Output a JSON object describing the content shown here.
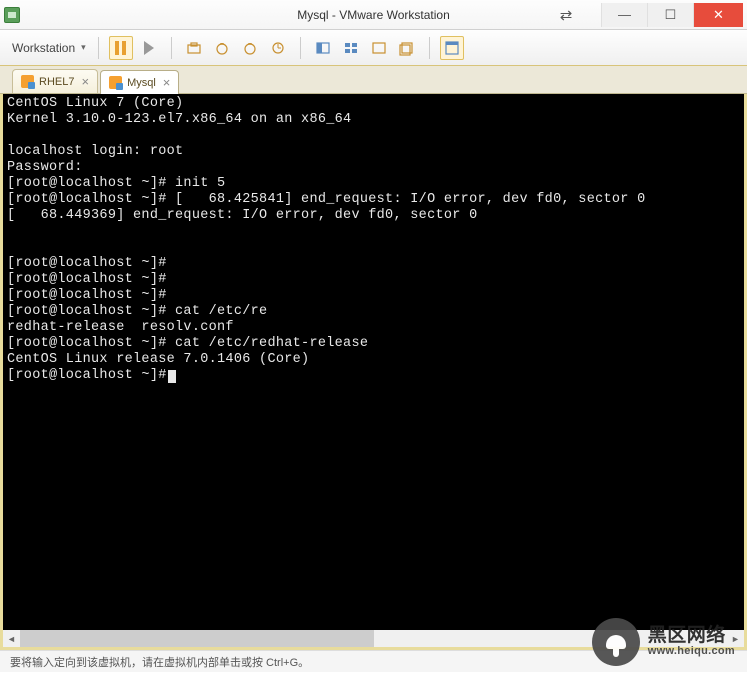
{
  "window": {
    "title": "Mysql - VMware Workstation"
  },
  "toolbar": {
    "menu_label": "Workstation"
  },
  "tabs": [
    {
      "label": "RHEL7",
      "active": false
    },
    {
      "label": "Mysql",
      "active": true
    }
  ],
  "terminal": {
    "lines": [
      "CentOS Linux 7 (Core)",
      "Kernel 3.10.0-123.el7.x86_64 on an x86_64",
      "",
      "localhost login: root",
      "Password:",
      "[root@localhost ~]# init 5",
      "[root@localhost ~]# [   68.425841] end_request: I/O error, dev fd0, sector 0",
      "[   68.449369] end_request: I/O error, dev fd0, sector 0",
      "",
      "",
      "[root@localhost ~]#",
      "[root@localhost ~]#",
      "[root@localhost ~]#",
      "[root@localhost ~]# cat /etc/re",
      "redhat-release  resolv.conf",
      "[root@localhost ~]# cat /etc/redhat-release",
      "CentOS Linux release 7.0.1406 (Core)",
      "[root@localhost ~]#"
    ]
  },
  "statusbar": {
    "message": "要将输入定向到该虚拟机，请在虚拟机内部单击或按 Ctrl+G。"
  },
  "watermark": {
    "line1": "黑区网络",
    "line2": "www.heiqu.com"
  }
}
